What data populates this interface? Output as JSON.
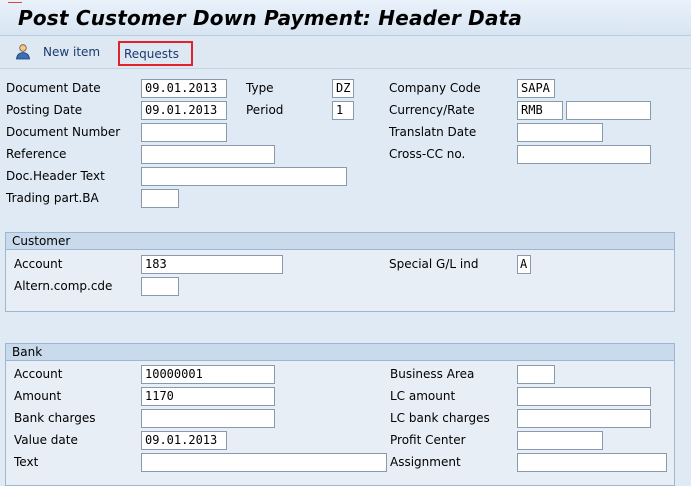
{
  "window": {
    "title": "Post Customer Down Payment: Header Data"
  },
  "toolbar": {
    "new_item": "New item",
    "requests": "Requests"
  },
  "header": {
    "document_date": {
      "label": "Document Date",
      "value": "09.01.2013"
    },
    "posting_date": {
      "label": "Posting Date",
      "value": "09.01.2013"
    },
    "document_number": {
      "label": "Document Number",
      "value": ""
    },
    "reference": {
      "label": "Reference",
      "value": ""
    },
    "doc_header_text": {
      "label": "Doc.Header Text",
      "value": ""
    },
    "trading_part_ba": {
      "label": "Trading part.BA",
      "value": ""
    },
    "type": {
      "label": "Type",
      "value": "DZ"
    },
    "period": {
      "label": "Period",
      "value": "1"
    },
    "company_code": {
      "label": "Company Code",
      "value": "SAPA"
    },
    "currency_rate": {
      "label": "Currency/Rate",
      "currency": "RMB",
      "rate": ""
    },
    "translatn_date": {
      "label": "Translatn Date",
      "value": ""
    },
    "cross_cc_no": {
      "label": "Cross-CC no.",
      "value": ""
    }
  },
  "customer": {
    "title": "Customer",
    "account": {
      "label": "Account",
      "value": "183"
    },
    "altern_comp_cde": {
      "label": "Altern.comp.cde",
      "value": ""
    },
    "special_gl_ind": {
      "label": "Special G/L ind",
      "value": "A"
    }
  },
  "bank": {
    "title": "Bank",
    "account": {
      "label": "Account",
      "value": "10000001"
    },
    "amount": {
      "label": "Amount",
      "value": "1170"
    },
    "bank_charges": {
      "label": "Bank charges",
      "value": ""
    },
    "value_date": {
      "label": "Value date",
      "value": "09.01.2013"
    },
    "text": {
      "label": "Text",
      "value": ""
    },
    "business_area": {
      "label": "Business Area",
      "value": ""
    },
    "lc_amount": {
      "label": "LC amount",
      "value": ""
    },
    "lc_bank_charges": {
      "label": "LC bank charges",
      "value": ""
    },
    "profit_center": {
      "label": "Profit Center",
      "value": ""
    },
    "assignment": {
      "label": "Assignment",
      "value": ""
    }
  },
  "icons": {
    "new_item": "person-icon"
  },
  "colors": {
    "highlight_box": "#e0232a",
    "background": "#dfeaf5"
  }
}
